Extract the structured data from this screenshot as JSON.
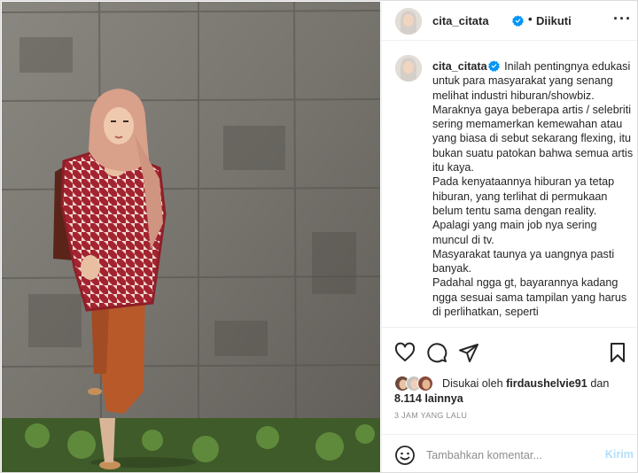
{
  "post": {
    "username": "cita_citata",
    "follow_separator": "•",
    "follow_status": "Diikuti",
    "more_icon": "more-options-icon",
    "caption_lines": [
      "Inilah pentingnya edukasi untuk para masyarakat yang senang melihat industri hiburan/showbiz.",
      "Maraknya gaya beberapa artis / selebriti sering memamerkan kemewahan atau yang biasa di sebut sekarang flexing, itu bukan suatu patokan bahwa semua artis itu kaya.",
      "Pada kenyataannya hiburan ya tetap hiburan, yang terlihat di permukaan belum tentu sama dengan reality.",
      "Apalagi yang main job nya sering muncul di tv.",
      "Masyarakat taunya ya uangnya pasti banyak.",
      "Padahal ngga gt, bayarannya kadang ngga sesuai sama tampilan yang harus di perlihatkan, seperti"
    ],
    "likes": {
      "prefix": "Disukai oleh",
      "liker": "firdaushelvie91",
      "joiner": "dan",
      "others": "8.114 lainnya"
    },
    "timestamp": "3 JAM YANG LALU",
    "comment": {
      "placeholder": "Tambahkan komentar...",
      "submit_label": "Kirim"
    }
  },
  "colors": {
    "verified": "#0095f6",
    "text": "#262626",
    "muted": "#8e8e8e",
    "post_disabled": "#b2dffc",
    "border": "#dbdbdb"
  }
}
